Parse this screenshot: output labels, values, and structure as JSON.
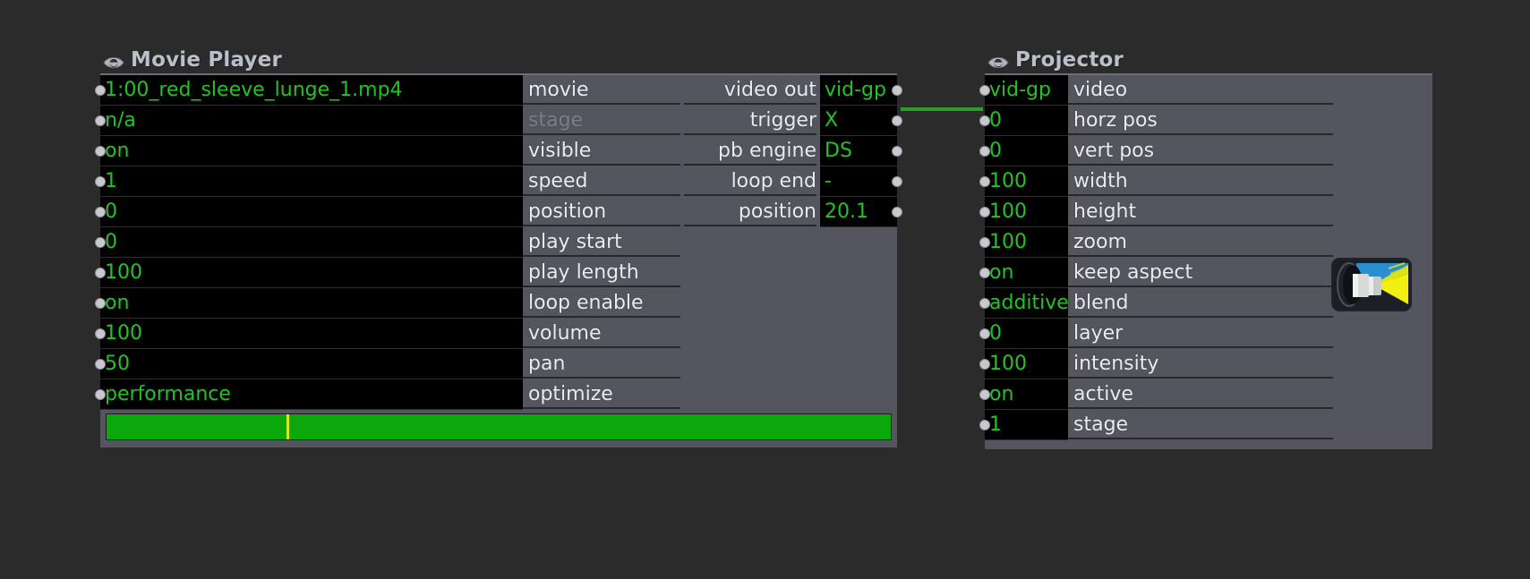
{
  "canvas": {
    "background": "#2b2b2b",
    "accent_green": "#22c322",
    "cable_color": "#2d9e2d",
    "node_body_color": "#55555f",
    "playhead_color": "#d8e818"
  },
  "nodes": [
    {
      "id": "movie-player",
      "title": "Movie Player",
      "eye_icon": "eye-icon",
      "inputs": [
        {
          "value": "1:00_red_sleeve_lunge_1.mp4",
          "label": "movie",
          "dim": false
        },
        {
          "value": "n/a",
          "label": "stage",
          "dim": true
        },
        {
          "value": "on",
          "label": "visible",
          "dim": false
        },
        {
          "value": "1",
          "label": "speed",
          "dim": false
        },
        {
          "value": "0",
          "label": "position",
          "dim": false
        },
        {
          "value": "0",
          "label": "play start",
          "dim": false
        },
        {
          "value": "100",
          "label": "play length",
          "dim": false
        },
        {
          "value": "on",
          "label": "loop enable",
          "dim": false
        },
        {
          "value": "100",
          "label": "volume",
          "dim": false
        },
        {
          "value": "50",
          "label": "pan",
          "dim": false
        },
        {
          "value": "performance",
          "label": "optimize",
          "dim": false
        }
      ],
      "outputs": [
        {
          "label": "video out",
          "value": "vid-gp"
        },
        {
          "label": "trigger",
          "value": "X"
        },
        {
          "label": "pb engine",
          "value": "DS"
        },
        {
          "label": "loop end",
          "value": "-"
        },
        {
          "label": "position",
          "value": "20.1"
        }
      ],
      "progress": {
        "fill_percent": 100,
        "playhead_percent": 23
      }
    },
    {
      "id": "projector",
      "title": "Projector",
      "eye_icon": "eye-icon",
      "thumbnail_icon": "projector-icon",
      "inputs": [
        {
          "value": "vid-gp",
          "label": "video"
        },
        {
          "value": "0",
          "label": "horz pos"
        },
        {
          "value": "0",
          "label": "vert pos"
        },
        {
          "value": "100",
          "label": "width"
        },
        {
          "value": "100",
          "label": "height"
        },
        {
          "value": "100",
          "label": "zoom"
        },
        {
          "value": "on",
          "label": "keep aspect"
        },
        {
          "value": "additive",
          "label": "blend"
        },
        {
          "value": "0",
          "label": "layer"
        },
        {
          "value": "100",
          "label": "intensity"
        },
        {
          "value": "on",
          "label": "active"
        },
        {
          "value": "1",
          "label": "stage"
        }
      ]
    }
  ],
  "connections": [
    {
      "from_node": "movie-player",
      "from_port": "video out",
      "to_node": "projector",
      "to_port": "video"
    }
  ]
}
